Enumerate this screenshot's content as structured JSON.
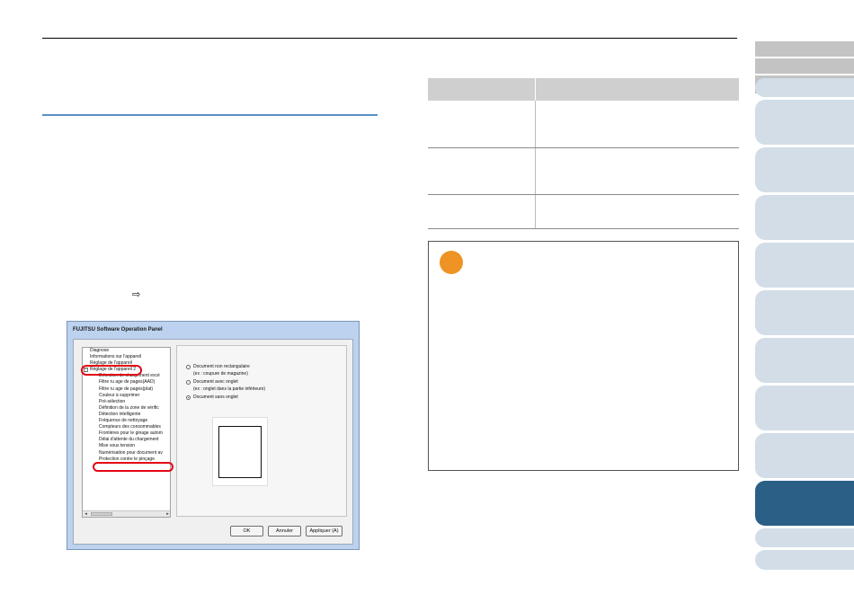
{
  "dialog": {
    "title": "FUJITSU Software Operation Panel",
    "tree": {
      "items": [
        {
          "label": "Diagnose",
          "level": 1
        },
        {
          "label": "Informations sur l'appareil",
          "level": 1
        },
        {
          "label": "Réglage de l'appareil",
          "level": 1
        },
        {
          "label": "Réglage de l'appareil 2",
          "level": 1,
          "expanded": true
        },
        {
          "label": "Détection de chargement excé",
          "level": 2
        },
        {
          "label": "Filtre ru age de pages(AAD)",
          "level": 2
        },
        {
          "label": "Filtre ru age de pages(plat)",
          "level": 2
        },
        {
          "label": "Couleur à supprimer",
          "level": 2
        },
        {
          "label": "Pré-sélection",
          "level": 2
        },
        {
          "label": "Définition de la zone de vérific",
          "level": 2
        },
        {
          "label": "Détection intelligente",
          "level": 2
        },
        {
          "label": "Fréquence de nettoyage",
          "level": 2
        },
        {
          "label": "Compteurs des consommables",
          "level": 2
        },
        {
          "label": "Frontières pour le ginage autom",
          "level": 2
        },
        {
          "label": "Délai d'attente du chargement",
          "level": 2
        },
        {
          "label": "Mise sous tension",
          "level": 2
        },
        {
          "label": "Numérisation pour document av",
          "level": 2
        },
        {
          "label": "Protection contre le pinçage",
          "level": 2
        }
      ],
      "collapse_symbol": "−",
      "scroll_left": "◂",
      "scroll_right": "▸"
    },
    "options": [
      {
        "label": "Document non rectangulaire",
        "sub": "(ex : coupure de magazine)",
        "selected": false
      },
      {
        "label": "Document avec onglet",
        "sub": "(ex : onglet dans la partie inférieure)",
        "selected": false
      },
      {
        "label": "Document sans onglet",
        "sub": "",
        "selected": true
      }
    ],
    "buttons": {
      "ok": "OK",
      "cancel": "Annuler",
      "apply": "Appliquer (A)"
    }
  },
  "step_arrow": "⇨",
  "colors": {
    "section_rule": "#5b8fc7",
    "highlight": "#e30613",
    "note_icon": "#ee9324",
    "active_tab": "#2b5f86",
    "inactive_tab": "#d2dde8",
    "gray_tab": "#c3c3c3"
  },
  "side_tabs": [
    {
      "name": "tab-1",
      "state": "gray"
    },
    {
      "name": "tab-2",
      "state": "gray"
    },
    {
      "name": "tab-3",
      "state": "gray"
    },
    {
      "name": "tab-4",
      "state": "light"
    },
    {
      "name": "tab-5",
      "state": "light"
    },
    {
      "name": "tab-6",
      "state": "light"
    },
    {
      "name": "tab-7",
      "state": "light"
    },
    {
      "name": "tab-8",
      "state": "light"
    },
    {
      "name": "tab-9",
      "state": "light"
    },
    {
      "name": "tab-10",
      "state": "light"
    },
    {
      "name": "tab-11",
      "state": "light"
    },
    {
      "name": "tab-12",
      "state": "light"
    },
    {
      "name": "tab-13",
      "state": "active"
    },
    {
      "name": "tab-14",
      "state": "light"
    },
    {
      "name": "tab-15",
      "state": "light"
    }
  ]
}
